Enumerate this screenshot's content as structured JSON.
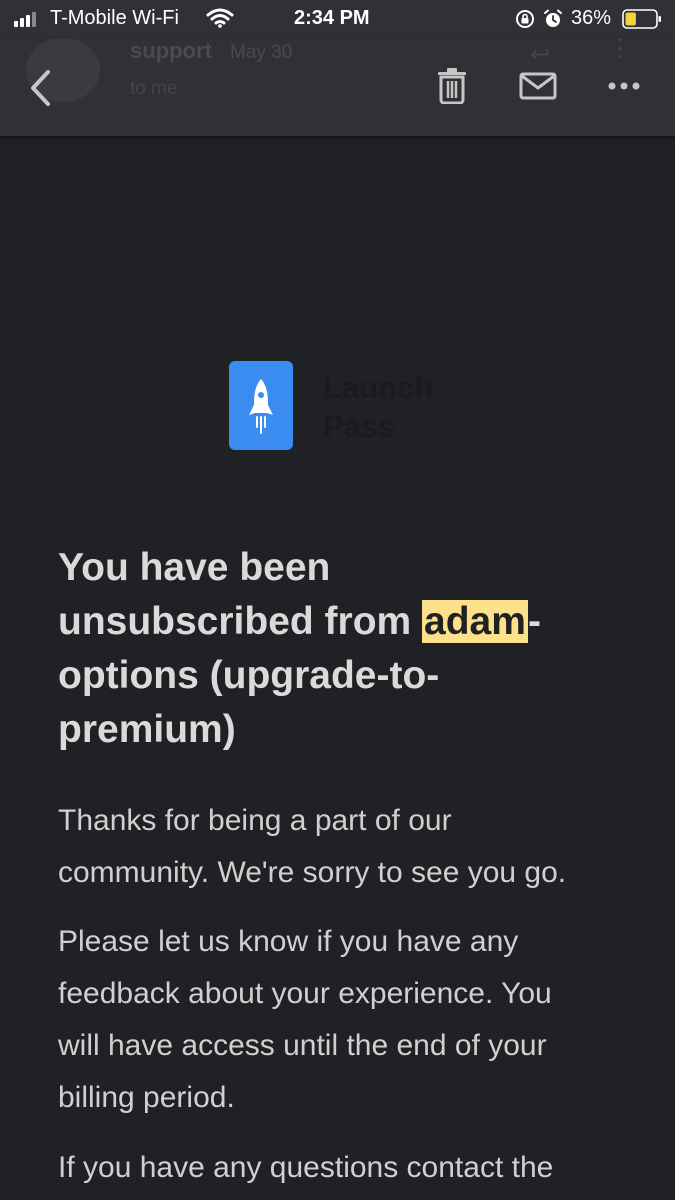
{
  "status_bar": {
    "carrier": "T-Mobile Wi-Fi",
    "time": "2:34 PM",
    "battery_percent": "36%",
    "battery_level": 0.36,
    "battery_color": "#f5d33d"
  },
  "email_header": {
    "sender_name": "support",
    "date": "May 30",
    "recipient": "to me"
  },
  "toolbar": {
    "back_icon": "chevron-left-icon",
    "delete_icon": "trash-icon",
    "mark_unread_icon": "mail-icon",
    "more_icon": "more-horizontal-icon"
  },
  "email_body": {
    "brand": {
      "logo_icon": "rocket-icon",
      "logo_color": "#3b8cf0",
      "name_line1": "Launch",
      "name_line2": "Pass"
    },
    "headline": {
      "line1": "You have been",
      "line2_prefix": "unsubscribed from ",
      "highlighted_word": "adam",
      "line2_suffix": "-",
      "line3": "options (upgrade-to-",
      "line4": "premium)",
      "highlight_color": "#fce08a"
    },
    "paragraph1": {
      "line1": "Thanks for being a part of our",
      "line2": "community. We're sorry to see you go."
    },
    "paragraph2": {
      "line1": "Please let us know if you have any",
      "line2": "feedback about your experience. You",
      "line3": "will have access until the end of your",
      "line4": "billing period."
    },
    "paragraph3": {
      "line1": "If you have any questions contact the"
    }
  }
}
